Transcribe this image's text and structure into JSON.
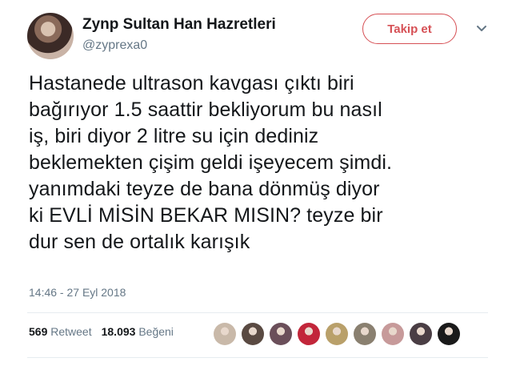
{
  "user": {
    "display_name": "Zynp Sultan Han Hazretleri",
    "handle": "@zyprexa0"
  },
  "follow_label": "Takip et",
  "tweet": {
    "text": "Hastanede ultrason kavgası çıktı biri\nbağırıyor 1.5 saattir bekliyorum bu nasıl\niş, biri diyor 2 litre su için dediniz\nbeklemekten çişim geldi işeyecem şimdi.\nyanımdaki teyze de bana dönmüş diyor\nki EVLİ MİSİN BEKAR MISIN? teyze bir\ndur sen de ortalık karışık",
    "timestamp": "14:46 - 27 Eyl 2018"
  },
  "stats": {
    "retweets_count": "569",
    "retweets_label": "Retweet",
    "likes_count": "18.093",
    "likes_label": "Beğeni"
  },
  "icons": {
    "more": "chevron-down-icon"
  },
  "liker_avatars": [
    {
      "color": "#c9b9a9"
    },
    {
      "color": "#5a4a42"
    },
    {
      "color": "#6b4f5a"
    },
    {
      "color": "#c2263a"
    },
    {
      "color": "#b9a06a"
    },
    {
      "color": "#8a8070"
    },
    {
      "color": "#c79a9a"
    },
    {
      "color": "#4a3e44"
    },
    {
      "color": "#1a1a1a"
    }
  ]
}
